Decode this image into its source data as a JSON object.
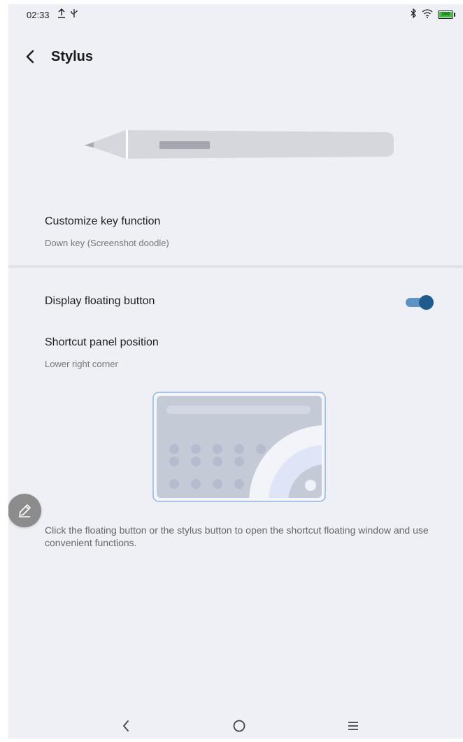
{
  "status_bar": {
    "time": "02:33",
    "left_icons": [
      "upload-icon",
      "usb-icon"
    ],
    "right_icons": [
      "bluetooth-icon",
      "wifi-icon",
      "battery-icon"
    ],
    "battery_level": 1.0,
    "battery_text": "100"
  },
  "header": {
    "title": "Stylus",
    "back_icon": "chevron-left-icon"
  },
  "key_function": {
    "title": "Customize key function",
    "subtitle": "Down key (Screenshot doodle)"
  },
  "floating_button_setting": {
    "label": "Display floating button",
    "enabled": true
  },
  "shortcut_panel": {
    "title": "Shortcut panel position",
    "subtitle": "Lower right corner"
  },
  "description": "Click the floating button or the stylus button to open the shortcut floating window and use convenient functions.",
  "floating_button": {
    "icon": "pen-icon"
  },
  "nav_bar": {
    "buttons": [
      "back-nav-icon",
      "home-nav-icon",
      "menu-nav-icon"
    ]
  },
  "colors": {
    "background": "#eef0f5",
    "toggle_track": "#5b93c4",
    "toggle_knob": "#1f5b8c",
    "panel_border": "#8fb3e6"
  }
}
